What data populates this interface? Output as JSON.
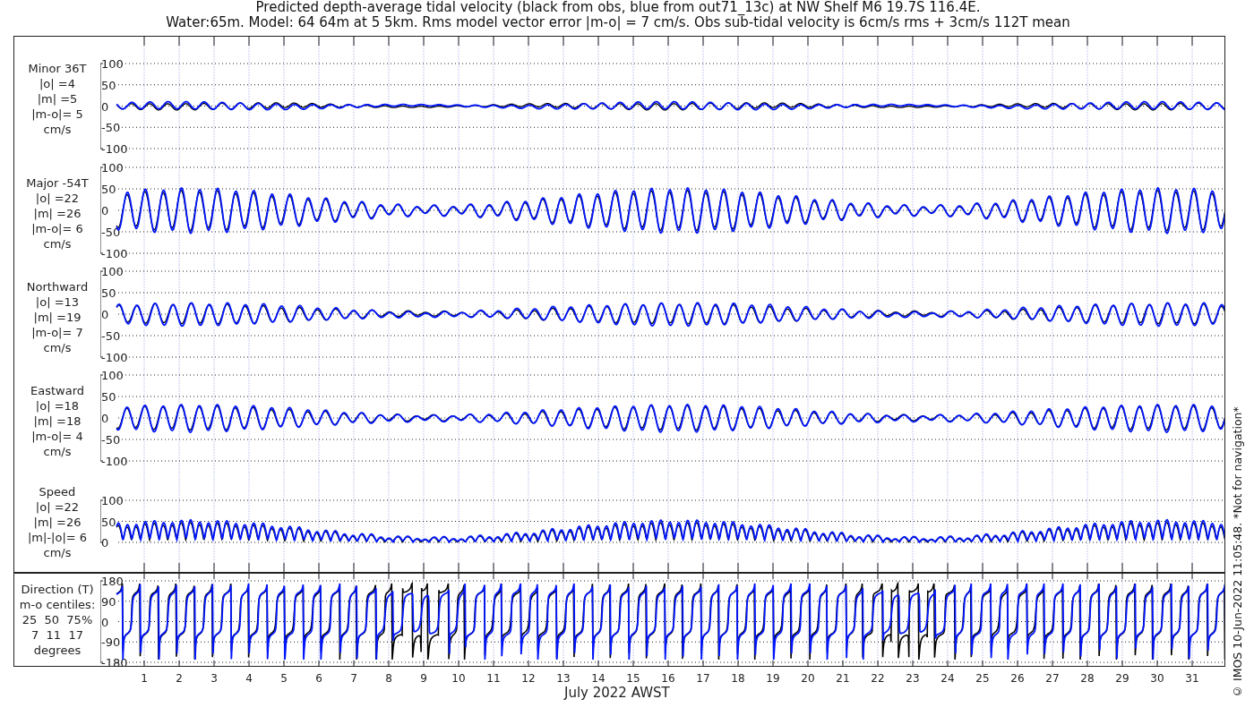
{
  "title_lines": [
    "Predicted depth-average tidal velocity (black from obs, blue from out71_13c) at NW Shelf M6 19.7S 116.4E.",
    "Water:65m. Model: 64 64m at 5 5km. Rms model vector error |m-o| = 7 cm/s. Obs sub-tidal velocity is 6cm/s rms + 3cm/s 112T mean"
  ],
  "panels": [
    {
      "kind": "minor",
      "label_lines": [
        "Minor 36T",
        "|o| =4",
        "|m| =5",
        "|m-o|= 5",
        "cm/s"
      ],
      "yticks": [
        "100",
        "50",
        "0",
        "-50",
        "-100"
      ]
    },
    {
      "kind": "major",
      "label_lines": [
        "Major -54T",
        "|o| =22",
        "|m| =26",
        "|m-o|= 6",
        "cm/s"
      ],
      "yticks": [
        "100",
        "50",
        "0",
        "-50",
        "-100"
      ]
    },
    {
      "kind": "north",
      "label_lines": [
        "Northward",
        "|o| =13",
        "|m| =19",
        "|m-o|= 7",
        "cm/s"
      ],
      "yticks": [
        "100",
        "50",
        "0",
        "-50",
        "-100"
      ]
    },
    {
      "kind": "east",
      "label_lines": [
        "Eastward",
        "|o| =18",
        "|m| =18",
        "|m-o|= 4",
        "cm/s"
      ],
      "yticks": [
        "100",
        "50",
        "0",
        "-50",
        "-100"
      ]
    },
    {
      "kind": "speed",
      "label_lines": [
        "Speed",
        "|o| =22",
        "|m| =26",
        "|m|-|o|= 6",
        "cm/s"
      ],
      "yticks": [
        "100",
        "50",
        "0"
      ]
    },
    {
      "kind": "direction",
      "label_lines": [
        "Direction (T)",
        "m-o centiles:",
        "25  50  75%",
        "7  11  17",
        "degrees"
      ],
      "yticks": [
        "180",
        "90",
        "0",
        "-90",
        "-180"
      ]
    }
  ],
  "xticks": [
    "1",
    "2",
    "3",
    "4",
    "5",
    "6",
    "7",
    "8",
    "9",
    "10",
    "11",
    "12",
    "13",
    "14",
    "15",
    "16",
    "17",
    "18",
    "19",
    "20",
    "21",
    "22",
    "23",
    "24",
    "25",
    "26",
    "27",
    "28",
    "29",
    "30",
    "31"
  ],
  "xlabel": "July 2022 AWST",
  "credit": "© IMOS 10-Jun-2022 11:05:48. *Not for navigation*"
}
